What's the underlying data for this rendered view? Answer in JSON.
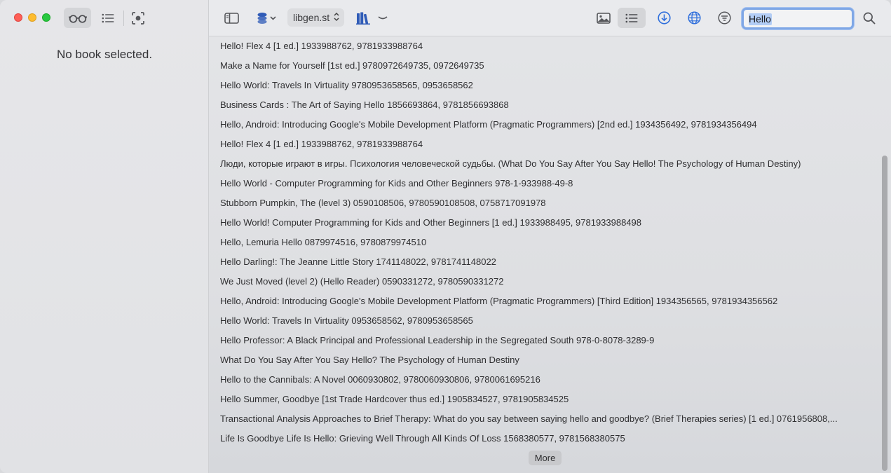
{
  "sidebar": {
    "empty_message": "No book selected."
  },
  "toolbar": {
    "source_label": "libgen.st",
    "search_value": "Hello",
    "icons": [
      "glasses-icon",
      "list-icon",
      "screenshot-icon",
      "sidebar-toggle-icon",
      "layers-icon",
      "books-icon",
      "chevron-icon",
      "image-icon",
      "list-view-icon",
      "download-icon",
      "globe-icon",
      "filter-icon",
      "search-icon"
    ]
  },
  "results": [
    "Hello! Flex 4 [1 ed.] 1933988762, 9781933988764",
    "Make a Name for Yourself [1st ed.] 9780972649735, 0972649735",
    "Hello World: Travels In Virtuality 9780953658565, 0953658562",
    "Business Cards : The Art of Saying Hello 1856693864, 9781856693868",
    "Hello, Android: Introducing Google's Mobile Development Platform (Pragmatic Programmers) [2nd ed.] 1934356492, 9781934356494",
    "Hello! Flex 4 [1 ed.] 1933988762, 9781933988764",
    "Люди, которые играют в игры. Психология человеческой судьбы. (What Do You Say After You Say Hello! The Psychology of Human Destiny)",
    "Hello World - Computer Programming for Kids and Other Beginners 978-1-933988-49-8",
    "Stubborn Pumpkin, The (level 3) 0590108506, 9780590108508, 0758717091978",
    "Hello World! Computer Programming for Kids and Other Beginners [1 ed.] 1933988495, 9781933988498",
    "Hello, Lemuria Hello 0879974516, 9780879974510",
    "Hello Darling!: The Jeanne Little Story 1741148022, 9781741148022",
    "We Just Moved (level 2) (Hello Reader) 0590331272, 9780590331272",
    "Hello, Android: Introducing Google's Mobile Development Platform (Pragmatic Programmers) [Third Edition] 1934356565, 9781934356562",
    "Hello World: Travels In Virtuality 0953658562, 9780953658565",
    "Hello Professor: A Black Principal and Professional Leadership in the Segregated South 978-0-8078-3289-9",
    "What Do You Say After You Say Hello? The Psychology of Human Destiny",
    "Hello to the Cannibals: A Novel 0060930802, 9780060930806, 9780061695216",
    "Hello Summer, Goodbye [1st Trade Hardcover thus ed.] 1905834527, 9781905834525",
    "Transactional Analysis Approaches to Brief Therapy: What do you say between saying hello and goodbye? (Brief Therapies series) [1 ed.] 0761956808,...",
    "Life Is Goodbye Life Is Hello: Grieving Well Through All Kinds Of Loss 1568380577, 9781568380575"
  ],
  "more_label": "More",
  "colors": {
    "accent": "#2f6fdc",
    "close": "#fe5f57",
    "minimize": "#febc2e",
    "maximize": "#28c840"
  }
}
